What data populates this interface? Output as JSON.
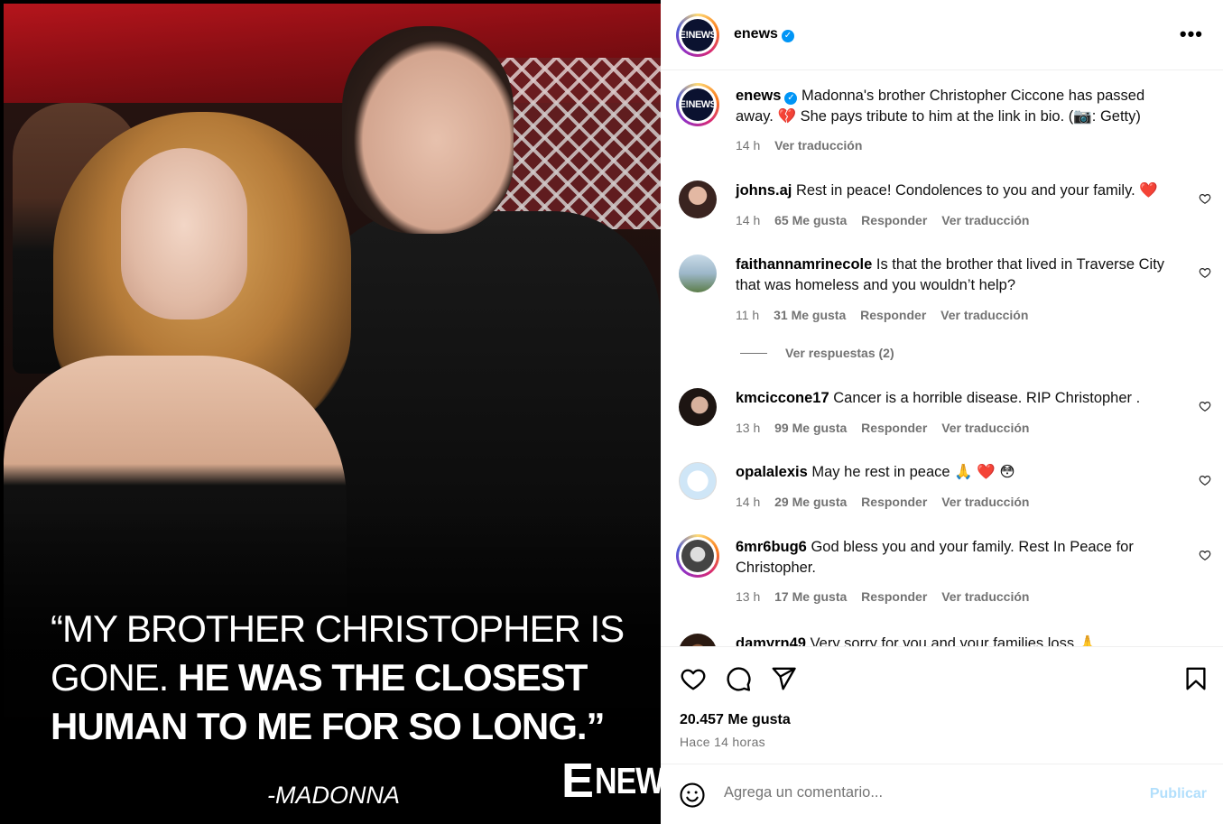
{
  "post": {
    "quote_thin_1": "“MY BROTHER CHRISTOPHER IS",
    "quote_thin_2": "GONE.",
    "quote_bold_2": "HE WAS THE CLOSEST",
    "quote_bold_3": "HUMAN TO ME FOR SO LONG.”",
    "attribution": "-MADONNA",
    "watermark_e": "E",
    "watermark_news": "NEWS"
  },
  "header": {
    "username": "enews",
    "avatar_text": "E!NEWS",
    "more_label": "•••"
  },
  "caption": {
    "username": "enews",
    "text": "Madonna's brother Christopher Ciccone has passed away. 💔 She pays tribute to him at the link in bio. (📷: Getty)",
    "time": "14 h",
    "translate": "Ver traducción"
  },
  "comments": [
    {
      "username": "johns.aj",
      "text": "Rest in peace! Condolences to you and your family. ❤️",
      "time": "14 h",
      "likes": "65 Me gusta",
      "reply": "Responder",
      "translate": "Ver traducción"
    },
    {
      "username": "faithannamrinecole",
      "text": "Is that the brother that lived in Traverse City that was homeless and you wouldn’t help?",
      "time": "11 h",
      "likes": "31 Me gusta",
      "reply": "Responder",
      "translate": "Ver traducción",
      "view_replies": "Ver respuestas (2)"
    },
    {
      "username": "kmciccone17",
      "text": "Cancer is a horrible disease. RIP Christopher .",
      "time": "13 h",
      "likes": "99 Me gusta",
      "reply": "Responder",
      "translate": "Ver traducción"
    },
    {
      "username": "opalalexis",
      "text": "May he rest in peace 🙏 ❤️ 😳",
      "time": "14 h",
      "likes": "29 Me gusta",
      "reply": "Responder",
      "translate": "Ver traducción"
    },
    {
      "username": "6mr6bug6",
      "text": "God bless you and your family. Rest In Peace for Christopher.",
      "time": "13 h",
      "likes": "17 Me gusta",
      "reply": "Responder",
      "translate": "Ver traducción"
    },
    {
      "username": "damyrn49",
      "text": "Very sorry for you and your families loss 🙏"
    }
  ],
  "footer": {
    "likes": "20.457 Me gusta",
    "ago": "Hace 14 horas",
    "comment_placeholder": "Agrega un comentario...",
    "publish": "Publicar"
  },
  "colors": {
    "verified": "#0095f6",
    "heart_red": "#ed4956",
    "muted_text": "#737373",
    "publish_disabled": "#b2dffc"
  },
  "icons": [
    "more-options-icon",
    "verified-badge-icon",
    "heart-icon",
    "comment-icon",
    "share-icon",
    "bookmark-icon",
    "emoji-icon",
    "like-comment-icon"
  ]
}
